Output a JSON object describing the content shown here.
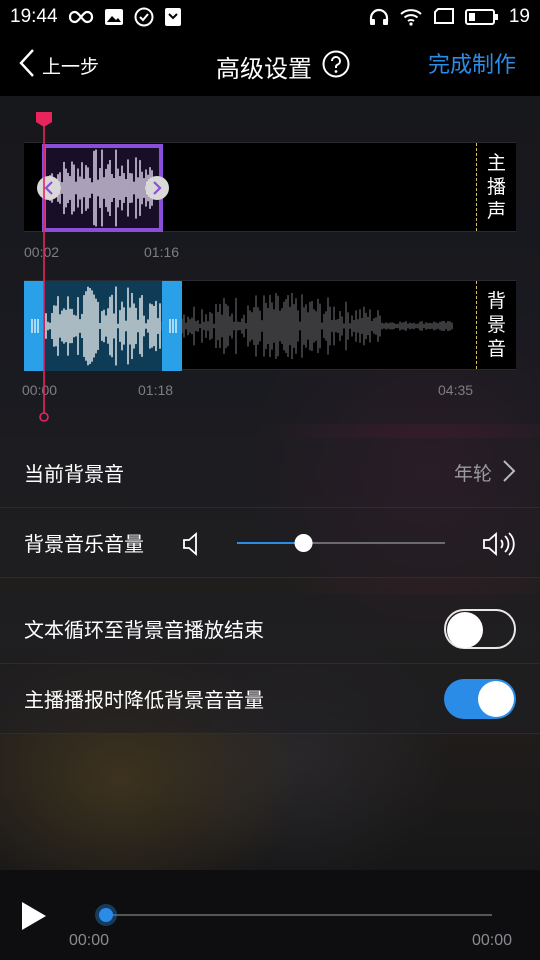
{
  "status_bar": {
    "time": "19:44",
    "battery": "19",
    "icons": [
      "infinity-icon",
      "image-icon",
      "check-circle-icon",
      "shield-icon",
      "headphones-icon",
      "wifi-icon",
      "screen-icon",
      "battery-icon"
    ]
  },
  "nav": {
    "back_label": "上一步",
    "title": "高级设置",
    "finish_label": "完成制作"
  },
  "editor": {
    "voice_track": {
      "label": [
        "主",
        "播",
        "声"
      ],
      "start_time": "00:02",
      "end_time": "01:16"
    },
    "bg_track": {
      "label": [
        "背",
        "景",
        "音"
      ],
      "start_time": "00:00",
      "mid_time": "01:18",
      "end_time": "04:35"
    }
  },
  "settings": {
    "current_bg": {
      "label": "当前背景音",
      "value": "年轮"
    },
    "bg_volume": {
      "label": "背景音乐音量",
      "level": 0.32
    },
    "loop_text": {
      "label": "文本循环至背景音播放结束",
      "enabled": false
    },
    "duck_bg": {
      "label": "主播播报时降低背景音音量",
      "enabled": true
    }
  },
  "player": {
    "current_time": "00:00",
    "total_time": "00:00",
    "progress": 0
  },
  "colors": {
    "accent": "#2b8ce8",
    "selection": "#8a4fd8",
    "playhead": "#e8245c",
    "bg_selection": "#2aa0e8"
  }
}
